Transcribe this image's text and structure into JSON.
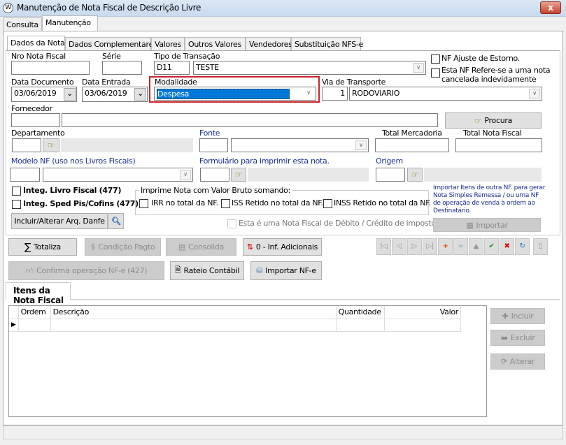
{
  "window": {
    "title": "Manutenção de Nota Fiscal de Descrição Livre",
    "close": "x"
  },
  "outer_tabs": [
    "Consulta",
    "Manutenção"
  ],
  "inner_tabs": [
    "Dados da Nota",
    "Dados Complementares",
    "Valores",
    "Outros Valores",
    "Vendedores",
    "Substituição NFS-e"
  ],
  "form": {
    "nro_label": "Nro Nota Fiscal",
    "nro_value": "",
    "serie_label": "Série",
    "serie_value": "",
    "tipo_label": "Tipo de Transação",
    "tipo_code": "D11",
    "tipo_value": "TESTE",
    "ajuste_label": "NF Ajuste de Estorno.",
    "cancelada_label": "Esta NF Refere-se a uma nota cancelada indevidamente",
    "data_doc_label": "Data Documento",
    "data_doc": "03/06/2019",
    "data_ent_label": "Data Entrada",
    "data_ent": "03/06/2019",
    "modalidade_label": "Modalidade",
    "modalidade": "Despesa",
    "via_label": "Via de Transporte",
    "via_code": "1",
    "via_value": "RODOVIARIO",
    "fornecedor_label": "Fornecedor",
    "procura": "Procura",
    "departamento_label": "Departamento",
    "fonte_label": "Fonte",
    "total_merc_label": "Total Mercadoria",
    "total_nf_label": "Total Nota Fiscal",
    "modelo_label": "Modelo NF (uso nos Livros Fiscais)",
    "formulario_label": "Formulário para imprimir esta nota.",
    "origem_label": "Origem",
    "integ_livro": "Integ. Livro Fiscal (477)",
    "integ_sped": "Integ. Sped Pis/Cofins (477)",
    "group_legend": "Imprime Nota com Valor Bruto somando:",
    "irr": "IRR no total da NF.",
    "iss": "ISS Retido no total da NF.",
    "inss": "INSS Retido no total da NF.",
    "importar_info": "Importar Itens de outra NF. para gerar Nota Simples Remessa / ou uma NF de operação de venda à ordem ao Destinatário.",
    "danfe_btn": "Incluir/Alterar Arq. Danfe",
    "debito_label": "Esta é uma Nota Fiscal de Débito / Crédito de impostos",
    "importar_btn": "Importar"
  },
  "actions": {
    "totaliza": "Totaliza",
    "condicao": "Condição Pagto",
    "consolida": "Consolida",
    "inf_adicionais": "0 - Inf. Adicionais",
    "confirma": "Confirma operação NF-e (427)",
    "rateio": "Rateio Contábil",
    "importar_nfe": "Importar NF-e"
  },
  "items": {
    "tab": "Itens da Nota Fiscal",
    "columns": [
      "Ordem",
      "Descrição",
      "Quantidade",
      "Valor"
    ],
    "incluir": "Incluir",
    "excluir": "Excluir",
    "alterar": "Alterar"
  },
  "colors": {
    "highlight": "#0078d7",
    "red_box": "#c8252c"
  }
}
